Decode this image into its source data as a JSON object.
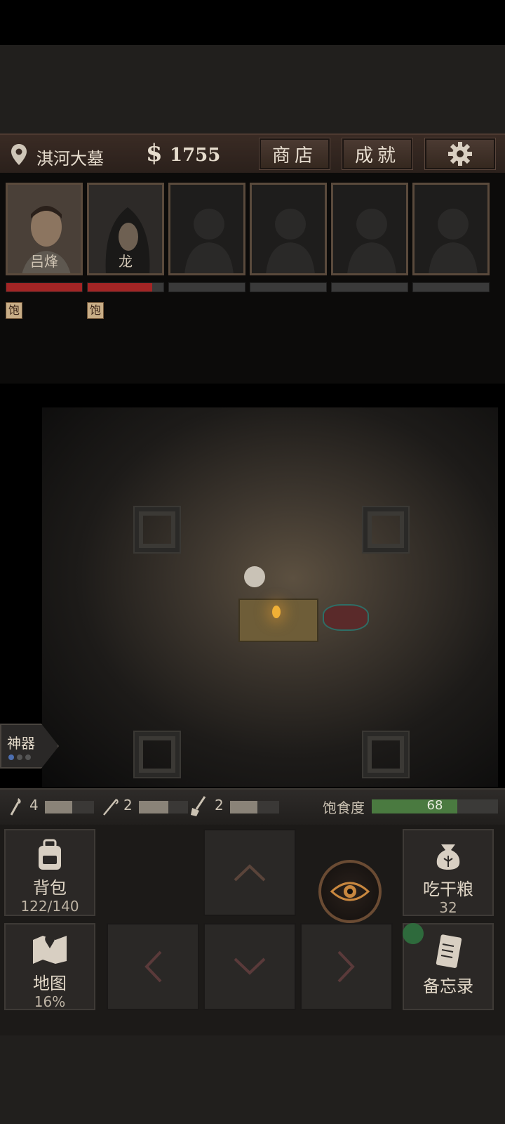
{
  "hud": {
    "location": "淇河大墓",
    "currency_symbol": "$",
    "money": "1755",
    "shop_label": "商店",
    "achievements_label": "成就",
    "settings_icon": "gear-icon"
  },
  "party": {
    "slots": [
      {
        "name": "吕烽",
        "hp_fraction": 1.0,
        "status": "饱"
      },
      {
        "name": "龙",
        "hp_fraction": 0.85,
        "status": "饱"
      },
      {
        "name": "",
        "hp_fraction": 0
      },
      {
        "name": "",
        "hp_fraction": 0
      },
      {
        "name": "",
        "hp_fraction": 0
      },
      {
        "name": "",
        "hp_fraction": 0
      }
    ]
  },
  "artifact": {
    "label": "神器",
    "gems_total": 3
  },
  "tools": {
    "torch_count": "4",
    "torch_level": 0.55,
    "rope_count": "2",
    "rope_level": 0.6,
    "shovel_count": "2",
    "shovel_level": 0.55
  },
  "hunger": {
    "label": "饱食度",
    "value": "68",
    "fraction": 0.68,
    "color": "#4a7a40"
  },
  "controls": {
    "backpack_label": "背包",
    "backpack_capacity": "122/140",
    "ration_label": "吃干粮",
    "ration_count": "32",
    "map_label": "地图",
    "map_progress": "16%",
    "memo_label": "备忘录"
  },
  "colors": {
    "hp": "#a32525",
    "hud_bg": "#3a2b24"
  }
}
